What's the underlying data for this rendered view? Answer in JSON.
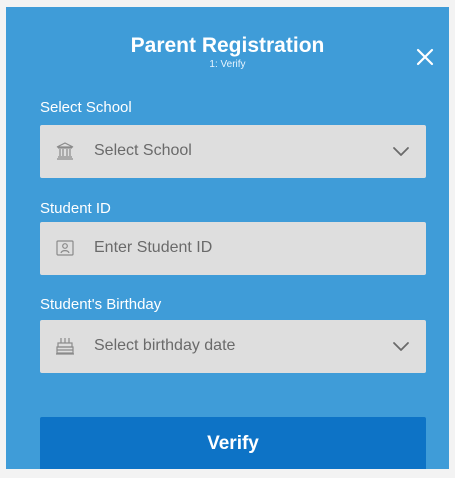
{
  "header": {
    "title": "Parent Registration",
    "subtitle": "1: Verify",
    "close_icon": "close-icon"
  },
  "fields": {
    "school": {
      "label": "Select School",
      "value": "",
      "placeholder": "Select School",
      "icon": "school-icon",
      "dropdown_icon": "chevron-down-icon"
    },
    "student_id": {
      "label": "Student ID",
      "value": "",
      "placeholder": "Enter Student ID",
      "icon": "id-card-icon"
    },
    "birthday": {
      "label": "Student's Birthday",
      "value": "",
      "placeholder": "Select birthday date",
      "icon": "cake-icon",
      "dropdown_icon": "chevron-down-icon"
    }
  },
  "actions": {
    "verify_label": "Verify"
  },
  "colors": {
    "page_background": "#f3f3f3",
    "modal_background": "#3f9cd8",
    "field_background": "#dedede",
    "button_background": "#0d73c6",
    "text_light": "#ffffff",
    "placeholder_text": "#6a6a6a"
  }
}
